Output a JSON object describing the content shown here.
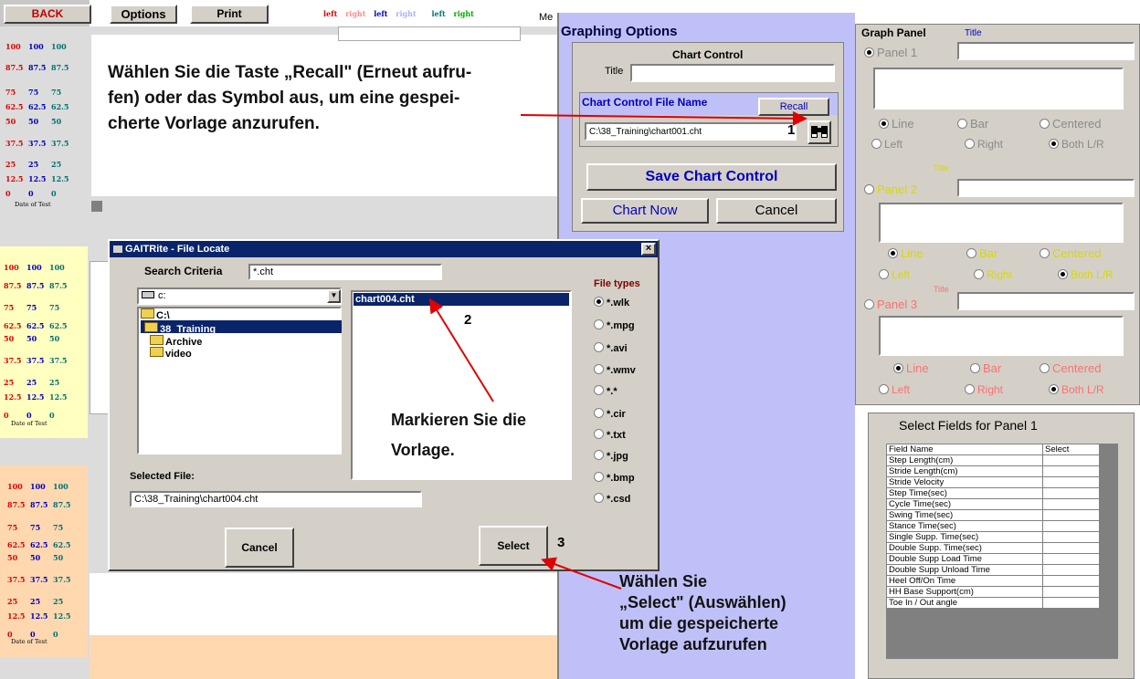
{
  "toolbar": {
    "back": "BACK",
    "options": "Options",
    "print": "Print",
    "legend": [
      {
        "text": "left",
        "color": "#e00000"
      },
      {
        "text": "right",
        "color": "#ff8a8a"
      },
      {
        "text": "left",
        "color": "#0000c0"
      },
      {
        "text": "right",
        "color": "#aab0ff"
      },
      {
        "text": "left",
        "color": "#007070"
      },
      {
        "text": "right",
        "color": "#00aa00"
      }
    ],
    "cut_text": "Me"
  },
  "scales": {
    "rows": [
      [
        "100",
        "100",
        "100"
      ],
      [
        "87.5",
        "87.5",
        "87.5"
      ],
      [
        "75",
        "75",
        "75"
      ],
      [
        "62.5",
        "62.5",
        "62.5"
      ],
      [
        "50",
        "50",
        "50"
      ],
      [
        "37.5",
        "37.5",
        "37.5"
      ],
      [
        "25",
        "25",
        "25"
      ],
      [
        "12.5",
        "12.5",
        "12.5"
      ],
      [
        "0",
        "0",
        "0"
      ]
    ],
    "date_label": "Date of Test"
  },
  "callouts": {
    "recall": "Wählen Sie die Taste „Recall\" (Erneut aufru-\nfen) oder das Symbol aus, um eine gespei-\ncherte Vorlage anzurufen.",
    "mark": "Markieren Sie die\nVorlage.",
    "select": "Wählen Sie\n„Select\" (Auswählen)\num die gespeicherte\nVorlage aufzurufen"
  },
  "steps": {
    "one": "1",
    "two": "2",
    "three": "3"
  },
  "graphing_options": {
    "title": "Graphing Options",
    "chart_control": "Chart Control",
    "title_label": "Title",
    "file_name_label": "Chart Control File Name",
    "recall": "Recall",
    "file_path": "C:\\38_Training\\chart001.cht",
    "save": "Save Chart Control",
    "chart_now": "Chart Now",
    "cancel": "Cancel"
  },
  "graph_panel": {
    "heading": "Graph Panel",
    "title_col": "Title",
    "panels": [
      {
        "name": "Panel 1",
        "title": "",
        "color": "#8a8a8a",
        "types": [
          "Line",
          "Bar",
          "Centered"
        ],
        "sides": [
          "Left",
          "Right",
          "Both L/R"
        ]
      },
      {
        "name": "Panel 2",
        "title": "Title",
        "color": "#d8d800",
        "types": [
          "Line",
          "Bar",
          "Centered"
        ],
        "sides": [
          "Left",
          "Right",
          "Both L/R"
        ]
      },
      {
        "name": "Panel 3",
        "title": "Title",
        "color": "#ff7070",
        "types": [
          "Line",
          "Bar",
          "Centered"
        ],
        "sides": [
          "Left",
          "Right",
          "Both L/R"
        ]
      }
    ]
  },
  "select_fields": {
    "title": "Select Fields for Panel 1",
    "headers": [
      "Field Name",
      "Select"
    ],
    "rows": [
      "Step Length(cm)",
      "Stride Length(cm)",
      "Stride Velocity",
      "Step Time(sec)",
      "Cycle Time(sec)",
      "Swing Time(sec)",
      "Stance Time(sec)",
      "Single Supp. Time(sec)",
      "Double Supp. Time(sec)",
      "Double Supp Load Time",
      "Double Supp Unload Time",
      "Heel Off/On Time",
      "HH Base Support(cm)",
      "Toe In / Out angle"
    ]
  },
  "dialog": {
    "title": "GAITRite - File Locate",
    "search_label": "Search Criteria",
    "search_value": "*.cht",
    "drive": "c:",
    "folders": [
      "C:\\",
      "38_Training",
      "Archive",
      "video"
    ],
    "files": [
      "chart004.cht"
    ],
    "file_types_label": "File types",
    "file_types": [
      "*.wlk",
      "*.mpg",
      "*.avi",
      "*.wmv",
      "*.*",
      "*.cir",
      "*.txt",
      "*.jpg",
      "*.bmp",
      "*.csd"
    ],
    "selected_label": "Selected File:",
    "selected_value": "C:\\38_Training\\chart004.cht",
    "cancel": "Cancel",
    "select": "Select",
    "close": "×"
  }
}
